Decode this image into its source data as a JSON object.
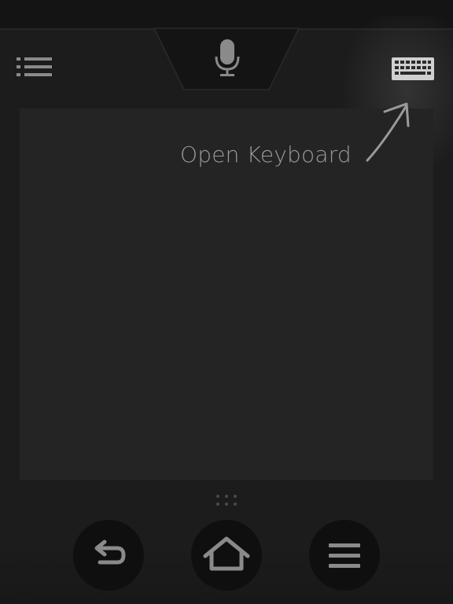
{
  "toolbar": {
    "list_icon": "list-icon",
    "mic_icon": "microphone-icon",
    "keyboard_icon": "keyboard-icon"
  },
  "touchpad": {
    "hint": "Open Keyboard",
    "hint_arrow_icon": "arrow-up-right-icon"
  },
  "navigation": {
    "drag_handle_icon": "dots-grid-icon",
    "back_icon": "back-arrow-icon",
    "home_icon": "home-icon",
    "menu_icon": "hamburger-menu-icon"
  },
  "colors": {
    "background": "#1c1c1c",
    "touchpad": "#242424",
    "button_circle": "#0f0f0f",
    "icon": "#8a8a8a",
    "hint_text": "#9a9a9a"
  }
}
